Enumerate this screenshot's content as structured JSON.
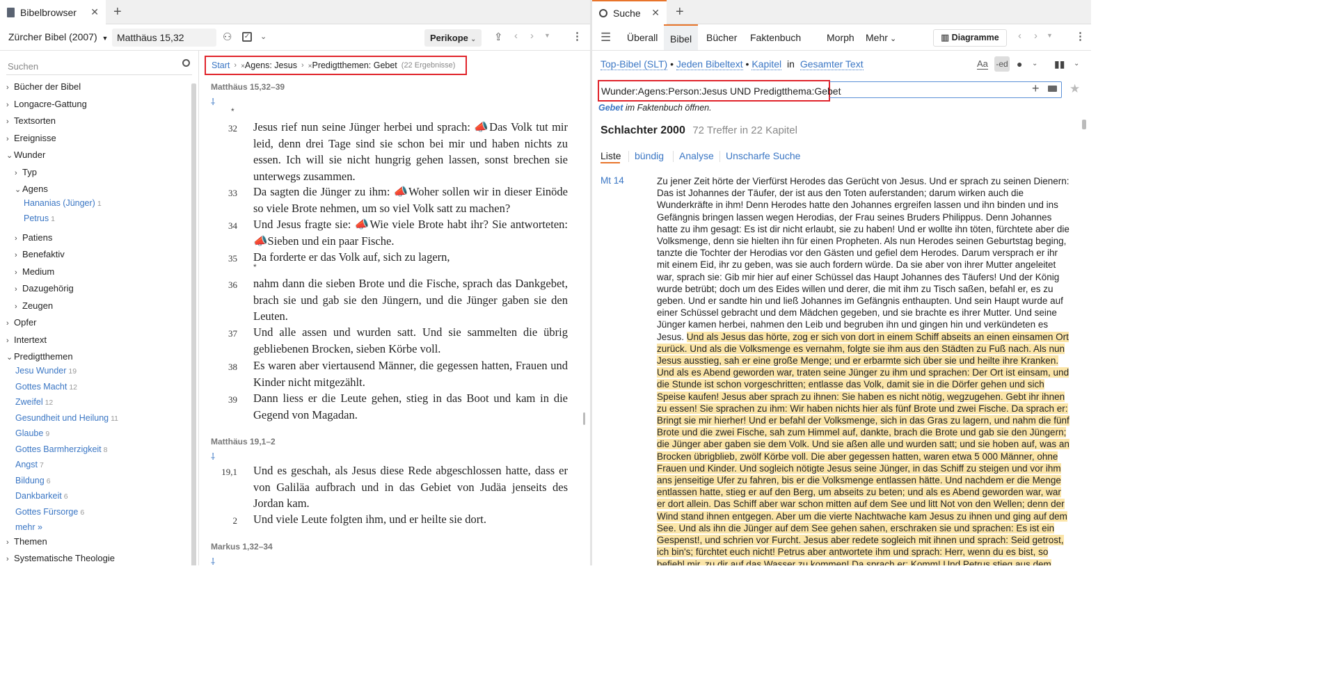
{
  "left_tabbar": {
    "tab_title": "Bibelbrowser"
  },
  "left_toolbar": {
    "bible_select": "Zürcher Bibel (2007)",
    "reference": "Matthäus 15,32",
    "pericope_button": "Perikope"
  },
  "sidebar": {
    "search_placeholder": "Suchen",
    "nodes": [
      "Bücher der Bibel",
      "Longacre-Gattung",
      "Textsorten",
      "Ereignisse",
      "Wunder",
      "Typ",
      "Agens",
      "Patiens",
      "Benefaktiv",
      "Medium",
      "Dazugehörig",
      "Zeugen",
      "Opfer",
      "Intertext",
      "Predigtthemen",
      "Themen",
      "Systematische Theologie"
    ],
    "agens_items": [
      {
        "label": "Hananias (Jünger)",
        "count": "1"
      },
      {
        "label": "Petrus",
        "count": "1"
      }
    ],
    "predigt_items": [
      {
        "label": "Jesu Wunder",
        "count": "19"
      },
      {
        "label": "Gottes Macht",
        "count": "12"
      },
      {
        "label": "Zweifel",
        "count": "12"
      },
      {
        "label": "Gesundheit und Heilung",
        "count": "11"
      },
      {
        "label": "Glaube",
        "count": "9"
      },
      {
        "label": "Gottes Barmherzigkeit",
        "count": "8"
      },
      {
        "label": "Angst",
        "count": "7"
      },
      {
        "label": "Bildung",
        "count": "6"
      },
      {
        "label": "Dankbarkeit",
        "count": "6"
      },
      {
        "label": "Gottes Fürsorge",
        "count": "6"
      },
      {
        "label": "mehr »",
        "count": ""
      }
    ]
  },
  "breadcrumb": {
    "start": "Start",
    "filter1": "Agens: Jesus",
    "filter2": "Predigtthemen: Gebet",
    "results": "(22 Ergebnisse)"
  },
  "passages": [
    {
      "ref": "Matthäus 15,32–39",
      "verses": [
        {
          "n": "32",
          "t": "Jesus rief nun seine Jünger herbei und sprach: 📣Das Volk tut mir leid, denn drei Tage sind sie schon bei mir und haben nichts zu essen. Ich will sie nicht hungrig gehen lassen, sonst brechen sie unterwegs zusammen."
        },
        {
          "n": "33",
          "t": "Da sagten die Jünger zu ihm: 📣Woher sollen wir in dieser Einöde so viele Brote nehmen, um so viel Volk satt zu machen?"
        },
        {
          "n": "34",
          "t": "Und Jesus fragte sie: 📣Wie viele Brote habt ihr? Sie antworteten: 📣Sieben und ein paar Fische."
        },
        {
          "n": "35",
          "t": "Da forderte er das Volk auf, sich zu lagern,"
        },
        {
          "n": "36",
          "t": "nahm dann die sieben Brote und die Fische, sprach das Dankgebet, brach sie und gab sie den Jüngern, und die Jünger gaben sie den Leuten."
        },
        {
          "n": "37",
          "t": "Und alle assen und wurden satt. Und sie sammelten die übrig gebliebenen Brocken, sieben Körbe voll."
        },
        {
          "n": "38",
          "t": "Es waren aber viertausend Männer, die gegessen hatten, Frauen und Kinder nicht mitgezählt."
        },
        {
          "n": "39",
          "t": "Dann liess er die Leute gehen, stieg in das Boot und kam in die Gegend von Magadan."
        }
      ]
    },
    {
      "ref": "Matthäus 19,1–2",
      "verses": [
        {
          "n": "19,1",
          "t": "Und es geschah, als Jesus diese Rede abgeschlossen hatte, dass er von Galiläa aufbrach und in das Gebiet von Judäa jenseits des Jordan kam."
        },
        {
          "n": "2",
          "t": "Und viele Leute folgten ihm, und er heilte sie dort."
        }
      ]
    },
    {
      "ref": "Markus 1,32–34",
      "verses": []
    }
  ],
  "right_tabbar": {
    "tab_title": "Suche"
  },
  "right_toolbar": {
    "tabs": [
      "Überall",
      "Bibel",
      "Bücher",
      "Faktenbuch",
      "Morph",
      "Mehr"
    ],
    "diagram_button": "Diagramme"
  },
  "search_scope": {
    "bible": "Top-Bibel (SLT)",
    "scope1": "Jeden Bibeltext",
    "scope2": "Kapitel",
    "in_word": "in",
    "scope3": "Gesamter Text"
  },
  "search_query": "Wunder:Agens:Person:Jesus UND Predigtthema:Gebet",
  "facts_hint": {
    "link": "Gebet",
    "text": " im Faktenbuch öffnen."
  },
  "results_header": {
    "bible": "Schlachter 2000",
    "summary": "72 Treffer in 22 Kapitel"
  },
  "result_tabs": [
    "Liste",
    "bündig",
    "Analyse",
    "Unscharfe Suche"
  ],
  "result": {
    "ref": "Mt 14",
    "plain": "Zu jener Zeit hörte der Vierfürst Herodes das Gerücht von Jesus. Und er sprach zu seinen Dienern: Das ist Johannes der Täufer, der ist aus den Toten auferstanden; darum wirken auch die Wunderkräfte in ihm! Denn Herodes hatte den Johannes ergreifen lassen und ihn binden und ins Gefängnis bringen lassen wegen Herodias, der Frau seines Bruders Philippus. Denn Johannes hatte zu ihm gesagt: Es ist dir nicht erlaubt, sie zu haben! Und er wollte ihn töten, fürchtete aber die Volksmenge, denn sie hielten ihn für einen Propheten. Als nun Herodes seinen Geburtstag beging, tanzte die Tochter der Herodias vor den Gästen und gefiel dem Herodes. Darum versprach er ihr mit einem Eid, ihr zu geben, was sie auch fordern würde. Da sie aber von ihrer Mutter angeleitet war, sprach sie: Gib mir hier auf einer Schüssel das Haupt Johannes des Täufers! Und der König wurde betrübt; doch um des Eides willen und derer, die mit ihm zu Tisch saßen, befahl er, es zu geben. Und er sandte hin und ließ Johannes im Gefängnis enthaupten. Und sein Haupt wurde auf einer Schüssel gebracht und dem Mädchen gegeben, und sie brachte es ihrer Mutter. Und seine Jünger kamen herbei, nahmen den Leib und begruben ihn und gingen hin und verkündeten es Jesus. ",
    "highlighted": "Und als Jesus das hörte, zog er sich von dort in einem Schiff abseits an einen einsamen Ort zurück. Und als die Volksmenge es vernahm, folgte sie ihm aus den Städten zu Fuß nach. Als nun Jesus ausstieg, sah er eine große Menge; und er erbarmte sich über sie und heilte ihre Kranken. Und als es Abend geworden war, traten seine Jünger zu ihm und sprachen: Der Ort ist einsam, und die Stunde ist schon vorgeschritten; entlasse das Volk, damit sie in die Dörfer gehen und sich Speise kaufen! Jesus aber sprach zu ihnen: Sie haben es nicht nötig, wegzugehen. Gebt ihr ihnen zu essen! Sie sprachen zu ihm: Wir haben nichts hier als fünf Brote und zwei Fische. Da sprach er: Bringt sie mir hierher! Und er befahl der Volksmenge, sich in das Gras zu lagern, und nahm die fünf Brote und die zwei Fische, sah zum Himmel auf, dankte, brach die Brote und gab sie den Jüngern; die Jünger aber gaben sie dem Volk. Und sie aßen alle und wurden satt; und sie hoben auf, was an Brocken übrigblieb, zwölf Körbe voll. Die aber gegessen hatten, waren etwa 5 000 Männer, ohne Frauen und Kinder. Und sogleich nötigte Jesus seine Jünger, in das Schiff zu steigen und vor ihm ans jenseitige Ufer zu fahren, bis er die Volksmenge entlassen hätte. Und nachdem er die Menge entlassen hatte, stieg er auf den Berg, um abseits zu beten; und als es Abend geworden war, war er dort allein. Das Schiff aber war schon mitten auf dem See und litt Not von den Wellen; denn der Wind stand ihnen entgegen. Aber um die vierte Nachtwache kam Jesus zu ihnen und ging auf dem See. Und als ihn die Jünger auf dem See gehen sahen, erschraken sie und sprachen: Es ist ein Gespenst!, und schrien vor Furcht. Jesus aber redete sogleich mit ihnen und sprach: Seid getrost, ich bin's; fürchtet euch nicht! Petrus aber antwortete ihm und sprach: Herr, wenn du es bist, so befiehl mir, zu dir auf das Wasser zu kommen! Da sprach er: Komm! Und Petrus stieg aus dem Schiff und ging auf dem Wasser, um zu"
  },
  "colors": {
    "accent": "#3a76c4",
    "highlight": "#fbe5a8",
    "annotation_box": "#e0232a",
    "active_tab": "#e8742a"
  }
}
